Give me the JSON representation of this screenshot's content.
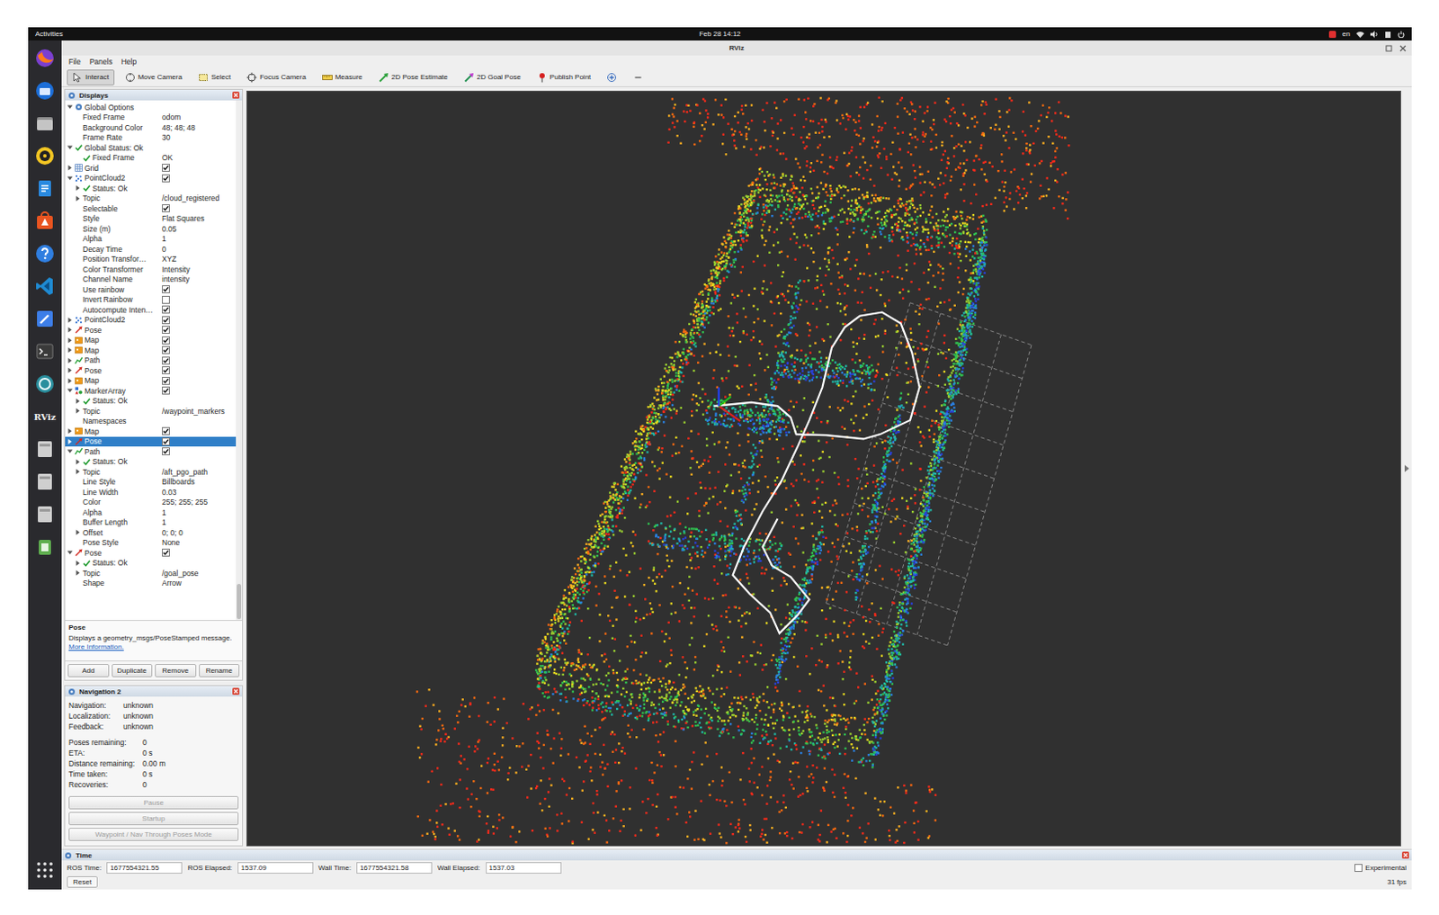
{
  "topbar": {
    "activities": "Activities",
    "clock": "Feb 28 14:12",
    "keyboard": "en"
  },
  "dock": {
    "label": "RViz"
  },
  "window": {
    "title": "RViz"
  },
  "menu": [
    "File",
    "Panels",
    "Help"
  ],
  "tools": [
    {
      "label": "Interact",
      "kind": "interact",
      "selected": true
    },
    {
      "label": "Move Camera",
      "kind": "camera",
      "selected": false
    },
    {
      "label": "Select",
      "kind": "select",
      "selected": false
    },
    {
      "label": "Focus Camera",
      "kind": "focus",
      "selected": false
    },
    {
      "label": "Measure",
      "kind": "measure",
      "selected": false
    },
    {
      "label": "2D Pose Estimate",
      "kind": "pose",
      "selected": false
    },
    {
      "label": "2D Goal Pose",
      "kind": "goal",
      "selected": false
    },
    {
      "label": "Publish Point",
      "kind": "point",
      "selected": false
    },
    {
      "label": "",
      "kind": "add",
      "selected": false
    },
    {
      "label": "",
      "kind": "remove",
      "selected": false
    }
  ],
  "displays": {
    "title": "Displays",
    "tree": [
      {
        "label": "Global Options",
        "kind": "options",
        "expanded": true,
        "selected": false,
        "children": [
          {
            "label": "Fixed Frame",
            "value": "odom",
            "kind": "property"
          },
          {
            "label": "Background Color",
            "value": "48; 48; 48",
            "kind": "property"
          },
          {
            "label": "Frame Rate",
            "value": "30",
            "kind": "property"
          }
        ]
      },
      {
        "label": "Global Status: Ok",
        "kind": "status",
        "expanded": true,
        "selected": false,
        "children": [
          {
            "label": "Fixed Frame",
            "value": "OK",
            "kind": "status"
          }
        ]
      },
      {
        "label": "Grid",
        "kind": "grid",
        "checked": true,
        "expanded": false,
        "selected": false
      },
      {
        "label": "PointCloud2",
        "kind": "cloud",
        "checked": true,
        "expanded": true,
        "selected": false,
        "children": [
          {
            "label": "Status: Ok",
            "kind": "status",
            "expanded": false
          },
          {
            "label": "Topic",
            "value": "/cloud_registered",
            "kind": "property",
            "expanded": false
          },
          {
            "label": "Selectable",
            "kind": "bool",
            "checked": true
          },
          {
            "label": "Style",
            "value": "Flat Squares",
            "kind": "property"
          },
          {
            "label": "Size (m)",
            "value": "0.05",
            "kind": "property"
          },
          {
            "label": "Alpha",
            "value": "1",
            "kind": "property"
          },
          {
            "label": "Decay Time",
            "value": "0",
            "kind": "property"
          },
          {
            "label": "Position Transfor…",
            "value": "XYZ",
            "kind": "property"
          },
          {
            "label": "Color Transformer",
            "value": "Intensity",
            "kind": "property"
          },
          {
            "label": "Channel Name",
            "value": "intensity",
            "kind": "property"
          },
          {
            "label": "Use rainbow",
            "kind": "bool",
            "checked": true
          },
          {
            "label": "Invert Rainbow",
            "kind": "bool",
            "checked": false
          },
          {
            "label": "Autocompute Inten…",
            "kind": "bool",
            "checked": true
          }
        ]
      },
      {
        "label": "PointCloud2",
        "kind": "cloud",
        "checked": true,
        "expanded": false,
        "selected": false
      },
      {
        "label": "Pose",
        "kind": "pose",
        "checked": true,
        "expanded": false,
        "selected": false
      },
      {
        "label": "Map",
        "kind": "map",
        "checked": true,
        "expanded": false,
        "selected": false
      },
      {
        "label": "Map",
        "kind": "map",
        "checked": true,
        "expanded": false,
        "selected": false
      },
      {
        "label": "Path",
        "kind": "path",
        "checked": true,
        "expanded": false,
        "selected": false
      },
      {
        "label": "Pose",
        "kind": "pose",
        "checked": true,
        "expanded": false,
        "selected": false
      },
      {
        "label": "Map",
        "kind": "map",
        "checked": true,
        "expanded": false,
        "selected": false
      },
      {
        "label": "MarkerArray",
        "kind": "markers",
        "checked": true,
        "expanded": true,
        "selected": false,
        "children": [
          {
            "label": "Status: Ok",
            "kind": "status",
            "expanded": false
          },
          {
            "label": "Topic",
            "value": "/waypoint_markers",
            "kind": "property",
            "expanded": false
          },
          {
            "label": "Namespaces",
            "value": "",
            "kind": "property"
          }
        ]
      },
      {
        "label": "Map",
        "kind": "map",
        "checked": true,
        "expanded": false,
        "selected": false
      },
      {
        "label": "Pose",
        "kind": "pose",
        "checked": true,
        "expanded": false,
        "selected": true
      },
      {
        "label": "Path",
        "kind": "path",
        "checked": true,
        "expanded": true,
        "selected": false,
        "children": [
          {
            "label": "Status: Ok",
            "kind": "status",
            "expanded": false
          },
          {
            "label": "Topic",
            "value": "/aft_pgo_path",
            "kind": "property",
            "expanded": false
          },
          {
            "label": "Line Style",
            "value": "Billboards",
            "kind": "property"
          },
          {
            "label": "Line Width",
            "value": "0.03",
            "kind": "property"
          },
          {
            "label": "Color",
            "value": "255; 255; 255",
            "kind": "property"
          },
          {
            "label": "Alpha",
            "value": "1",
            "kind": "property"
          },
          {
            "label": "Buffer Length",
            "value": "1",
            "kind": "property"
          },
          {
            "label": "Offset",
            "value": "0; 0; 0",
            "kind": "property",
            "expanded": false
          },
          {
            "label": "Pose Style",
            "value": "None",
            "kind": "property"
          }
        ]
      },
      {
        "label": "Pose",
        "kind": "pose",
        "checked": true,
        "expanded": true,
        "selected": false,
        "children": [
          {
            "label": "Status: Ok",
            "kind": "status",
            "expanded": false
          },
          {
            "label": "Topic",
            "value": "/goal_pose",
            "kind": "property",
            "expanded": false
          },
          {
            "label": "Shape",
            "value": "Arrow",
            "kind": "property"
          }
        ]
      }
    ],
    "description": {
      "title": "Pose",
      "text": "Displays a geometry_msgs/PoseStamped message.",
      "link": "More Information."
    },
    "buttons": [
      "Add",
      "Duplicate",
      "Remove",
      "Rename"
    ]
  },
  "nav": {
    "title": "Navigation 2",
    "status": [
      {
        "label": "Navigation:",
        "value": "unknown"
      },
      {
        "label": "Localization:",
        "value": "unknown"
      },
      {
        "label": "Feedback:",
        "value": "unknown"
      }
    ],
    "stats": [
      {
        "label": "Poses remaining:",
        "value": "0"
      },
      {
        "label": "ETA:",
        "value": "0 s"
      },
      {
        "label": "Distance remaining:",
        "value": "0.00 m"
      },
      {
        "label": "Time taken:",
        "value": "0 s"
      },
      {
        "label": "Recoveries:",
        "value": "0"
      }
    ],
    "buttons": [
      {
        "label": "Pause",
        "disabled": true
      },
      {
        "label": "Startup",
        "disabled": true
      },
      {
        "label": "Waypoint / Nav Through Poses Mode",
        "disabled": true
      }
    ]
  },
  "time": {
    "title": "Time",
    "fields": [
      {
        "label": "ROS Time:",
        "value": "1677554321.55"
      },
      {
        "label": "ROS Elapsed:",
        "value": "1537.09"
      },
      {
        "label": "Wall Time:",
        "value": "1677554321.58"
      },
      {
        "label": "Wall Elapsed:",
        "value": "1537.03"
      }
    ],
    "experimental": {
      "label": "Experimental",
      "checked": false
    },
    "reset": "Reset",
    "fps": "31 fps"
  }
}
